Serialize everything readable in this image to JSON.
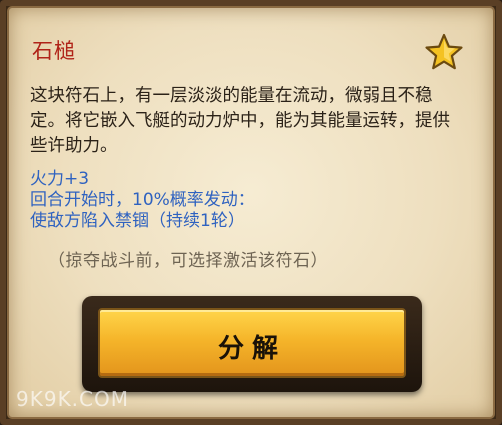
{
  "rune": {
    "title": "石槌",
    "description": "这块符石上，有一层淡淡的能量在流动，微弱且不稳定。将它嵌入飞艇的动力炉中，能为其能量运转，提供些许助力。",
    "effects": [
      "火力+3",
      "回合开始时，10%概率发动：",
      "使敌方陷入禁锢（持续1轮）"
    ],
    "hint": "（掠夺战斗前，可选择激活该符石）",
    "favorite_icon": "star-icon"
  },
  "actions": {
    "decompose_label": "分解"
  },
  "watermark": "9K9K.COM",
  "colors": {
    "title": "#b02318",
    "effects": "#2f62c0",
    "button": "#f5b52a",
    "star": "#f4c222"
  }
}
